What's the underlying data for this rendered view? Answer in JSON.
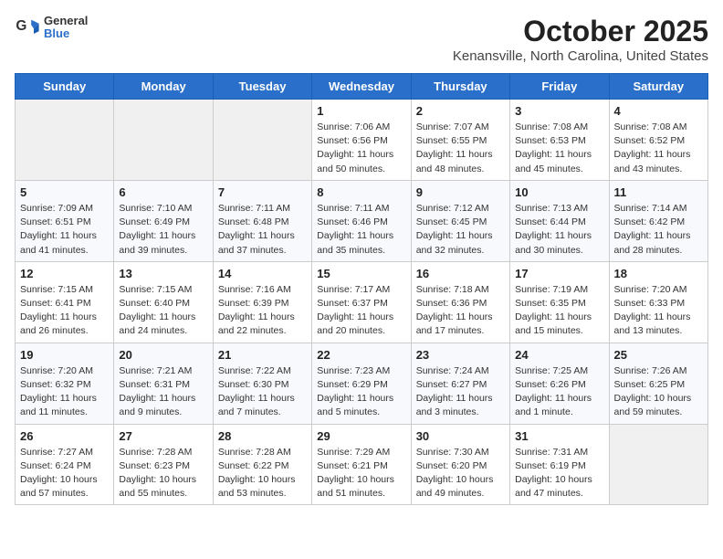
{
  "logo": {
    "line1": "General",
    "line2": "Blue"
  },
  "title": "October 2025",
  "subtitle": "Kenansville, North Carolina, United States",
  "weekdays": [
    "Sunday",
    "Monday",
    "Tuesday",
    "Wednesday",
    "Thursday",
    "Friday",
    "Saturday"
  ],
  "weeks": [
    [
      {
        "day": "",
        "info": ""
      },
      {
        "day": "",
        "info": ""
      },
      {
        "day": "",
        "info": ""
      },
      {
        "day": "1",
        "info": "Sunrise: 7:06 AM\nSunset: 6:56 PM\nDaylight: 11 hours\nand 50 minutes."
      },
      {
        "day": "2",
        "info": "Sunrise: 7:07 AM\nSunset: 6:55 PM\nDaylight: 11 hours\nand 48 minutes."
      },
      {
        "day": "3",
        "info": "Sunrise: 7:08 AM\nSunset: 6:53 PM\nDaylight: 11 hours\nand 45 minutes."
      },
      {
        "day": "4",
        "info": "Sunrise: 7:08 AM\nSunset: 6:52 PM\nDaylight: 11 hours\nand 43 minutes."
      }
    ],
    [
      {
        "day": "5",
        "info": "Sunrise: 7:09 AM\nSunset: 6:51 PM\nDaylight: 11 hours\nand 41 minutes."
      },
      {
        "day": "6",
        "info": "Sunrise: 7:10 AM\nSunset: 6:49 PM\nDaylight: 11 hours\nand 39 minutes."
      },
      {
        "day": "7",
        "info": "Sunrise: 7:11 AM\nSunset: 6:48 PM\nDaylight: 11 hours\nand 37 minutes."
      },
      {
        "day": "8",
        "info": "Sunrise: 7:11 AM\nSunset: 6:46 PM\nDaylight: 11 hours\nand 35 minutes."
      },
      {
        "day": "9",
        "info": "Sunrise: 7:12 AM\nSunset: 6:45 PM\nDaylight: 11 hours\nand 32 minutes."
      },
      {
        "day": "10",
        "info": "Sunrise: 7:13 AM\nSunset: 6:44 PM\nDaylight: 11 hours\nand 30 minutes."
      },
      {
        "day": "11",
        "info": "Sunrise: 7:14 AM\nSunset: 6:42 PM\nDaylight: 11 hours\nand 28 minutes."
      }
    ],
    [
      {
        "day": "12",
        "info": "Sunrise: 7:15 AM\nSunset: 6:41 PM\nDaylight: 11 hours\nand 26 minutes."
      },
      {
        "day": "13",
        "info": "Sunrise: 7:15 AM\nSunset: 6:40 PM\nDaylight: 11 hours\nand 24 minutes."
      },
      {
        "day": "14",
        "info": "Sunrise: 7:16 AM\nSunset: 6:39 PM\nDaylight: 11 hours\nand 22 minutes."
      },
      {
        "day": "15",
        "info": "Sunrise: 7:17 AM\nSunset: 6:37 PM\nDaylight: 11 hours\nand 20 minutes."
      },
      {
        "day": "16",
        "info": "Sunrise: 7:18 AM\nSunset: 6:36 PM\nDaylight: 11 hours\nand 17 minutes."
      },
      {
        "day": "17",
        "info": "Sunrise: 7:19 AM\nSunset: 6:35 PM\nDaylight: 11 hours\nand 15 minutes."
      },
      {
        "day": "18",
        "info": "Sunrise: 7:20 AM\nSunset: 6:33 PM\nDaylight: 11 hours\nand 13 minutes."
      }
    ],
    [
      {
        "day": "19",
        "info": "Sunrise: 7:20 AM\nSunset: 6:32 PM\nDaylight: 11 hours\nand 11 minutes."
      },
      {
        "day": "20",
        "info": "Sunrise: 7:21 AM\nSunset: 6:31 PM\nDaylight: 11 hours\nand 9 minutes."
      },
      {
        "day": "21",
        "info": "Sunrise: 7:22 AM\nSunset: 6:30 PM\nDaylight: 11 hours\nand 7 minutes."
      },
      {
        "day": "22",
        "info": "Sunrise: 7:23 AM\nSunset: 6:29 PM\nDaylight: 11 hours\nand 5 minutes."
      },
      {
        "day": "23",
        "info": "Sunrise: 7:24 AM\nSunset: 6:27 PM\nDaylight: 11 hours\nand 3 minutes."
      },
      {
        "day": "24",
        "info": "Sunrise: 7:25 AM\nSunset: 6:26 PM\nDaylight: 11 hours\nand 1 minute."
      },
      {
        "day": "25",
        "info": "Sunrise: 7:26 AM\nSunset: 6:25 PM\nDaylight: 10 hours\nand 59 minutes."
      }
    ],
    [
      {
        "day": "26",
        "info": "Sunrise: 7:27 AM\nSunset: 6:24 PM\nDaylight: 10 hours\nand 57 minutes."
      },
      {
        "day": "27",
        "info": "Sunrise: 7:28 AM\nSunset: 6:23 PM\nDaylight: 10 hours\nand 55 minutes."
      },
      {
        "day": "28",
        "info": "Sunrise: 7:28 AM\nSunset: 6:22 PM\nDaylight: 10 hours\nand 53 minutes."
      },
      {
        "day": "29",
        "info": "Sunrise: 7:29 AM\nSunset: 6:21 PM\nDaylight: 10 hours\nand 51 minutes."
      },
      {
        "day": "30",
        "info": "Sunrise: 7:30 AM\nSunset: 6:20 PM\nDaylight: 10 hours\nand 49 minutes."
      },
      {
        "day": "31",
        "info": "Sunrise: 7:31 AM\nSunset: 6:19 PM\nDaylight: 10 hours\nand 47 minutes."
      },
      {
        "day": "",
        "info": ""
      }
    ]
  ]
}
